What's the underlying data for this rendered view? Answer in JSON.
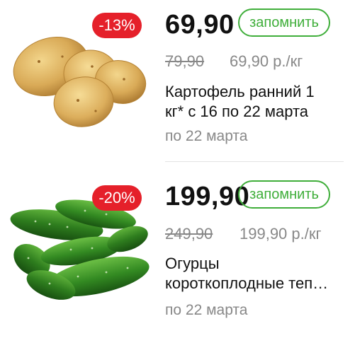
{
  "products": [
    {
      "discount": "-13%",
      "price": "69,90",
      "remember_label": "запомнить",
      "old_price": "79,90",
      "unit_price": "69,90 р./кг",
      "name_lines": [
        "Картофель ранний 1",
        "кг* с 16 по 22 марта"
      ],
      "valid_until": "по 22 марта",
      "image": "potatoes-image"
    },
    {
      "discount": "-20%",
      "price": "199,90",
      "remember_label": "запомнить",
      "old_price": "249,90",
      "unit_price": "199,90 р./кг",
      "name_lines": [
        "Огурцы",
        "короткоплодные теп…"
      ],
      "valid_until": "по 22 марта",
      "image": "cucumbers-image"
    }
  ],
  "colors": {
    "badge": "#e5202a",
    "accent_green": "#3fae3a",
    "muted_text": "#888888",
    "main_text": "#111111"
  }
}
